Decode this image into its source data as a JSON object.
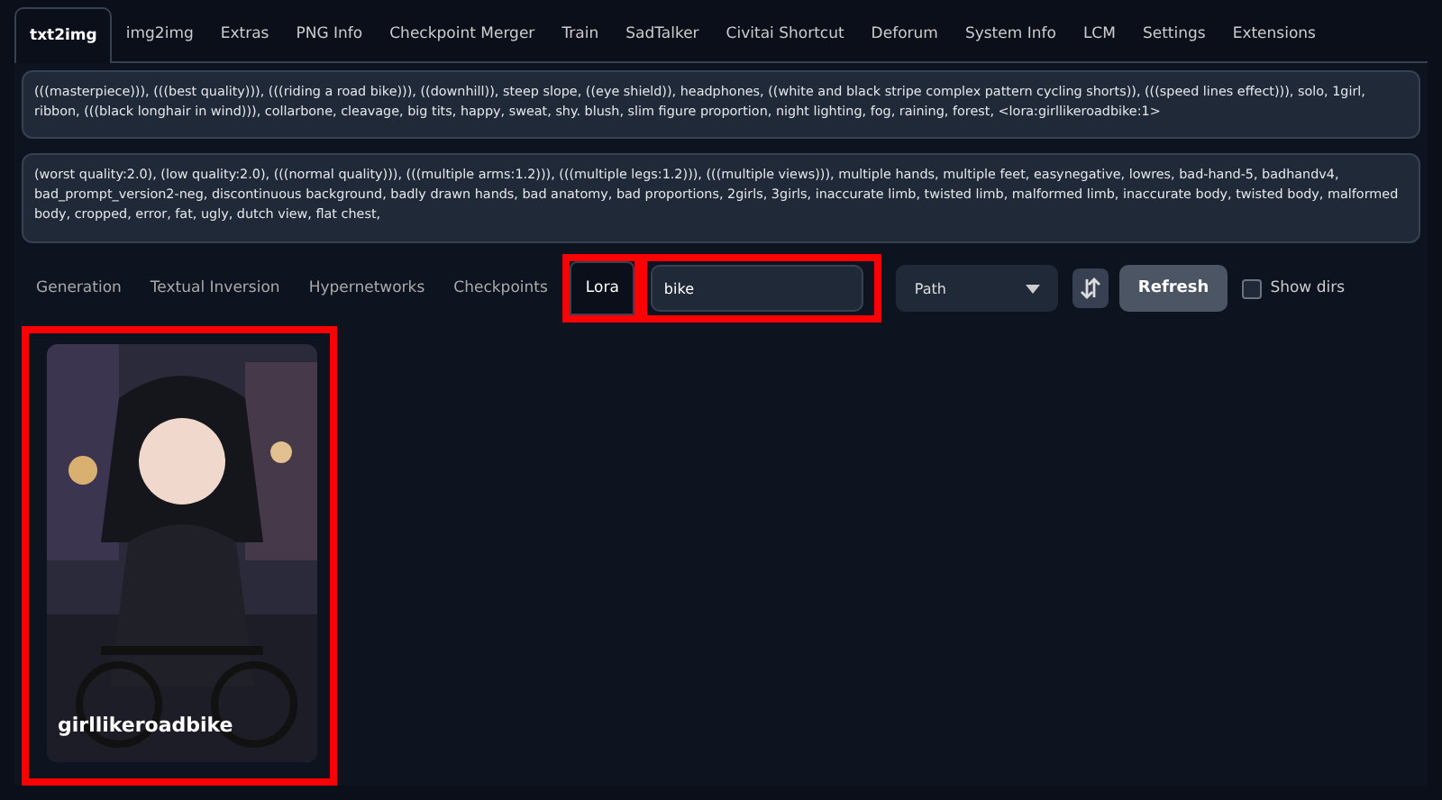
{
  "tabs": [
    {
      "label": "txt2img",
      "selected": true
    },
    {
      "label": "img2img",
      "selected": false
    },
    {
      "label": "Extras",
      "selected": false
    },
    {
      "label": "PNG Info",
      "selected": false
    },
    {
      "label": "Checkpoint Merger",
      "selected": false
    },
    {
      "label": "Train",
      "selected": false
    },
    {
      "label": "SadTalker",
      "selected": false
    },
    {
      "label": "Civitai Shortcut",
      "selected": false
    },
    {
      "label": "Deforum",
      "selected": false
    },
    {
      "label": "System Info",
      "selected": false
    },
    {
      "label": "LCM",
      "selected": false
    },
    {
      "label": "Settings",
      "selected": false
    },
    {
      "label": "Extensions",
      "selected": false
    }
  ],
  "prompt": {
    "value": "(((masterpiece))), (((best quality))), (((riding a road bike))), ((downhill)), steep slope, ((eye shield)), headphones, ((white and black stripe complex pattern cycling shorts)), (((speed lines effect))), solo, 1girl, ribbon, (((black longhair in wind))), collarbone, cleavage, big tits, happy, sweat, shy. blush, slim figure proportion, night lighting, fog, raining, forest, <lora:girllikeroadbike:1>"
  },
  "negative_prompt": {
    "value": "(worst quality:2.0), (low quality:2.0), (((normal quality))), (((multiple arms:1.2))), (((multiple legs:1.2))), (((multiple views))), multiple hands, multiple feet, easynegative, lowres, bad-hand-5, badhandv4, bad_prompt_version2-neg, discontinuous background, badly drawn hands, bad anatomy, bad proportions, 2girls, 3girls, inaccurate limb, twisted limb, malformed limb, inaccurate body, twisted body, malformed body, cropped, error, fat, ugly, dutch view, flat chest,"
  },
  "extra_tabs": [
    {
      "label": "Generation",
      "selected": false
    },
    {
      "label": "Textual Inversion",
      "selected": false
    },
    {
      "label": "Hypernetworks",
      "selected": false
    },
    {
      "label": "Checkpoints",
      "selected": false
    },
    {
      "label": "Lora",
      "selected": true
    }
  ],
  "search": {
    "value": "bike"
  },
  "sort": {
    "value": "Path"
  },
  "refresh_button": "Refresh",
  "show_dirs": {
    "label": "Show dirs",
    "checked": false
  },
  "cards": [
    {
      "name": "girllikeroadbike",
      "kind": "picture"
    }
  ]
}
